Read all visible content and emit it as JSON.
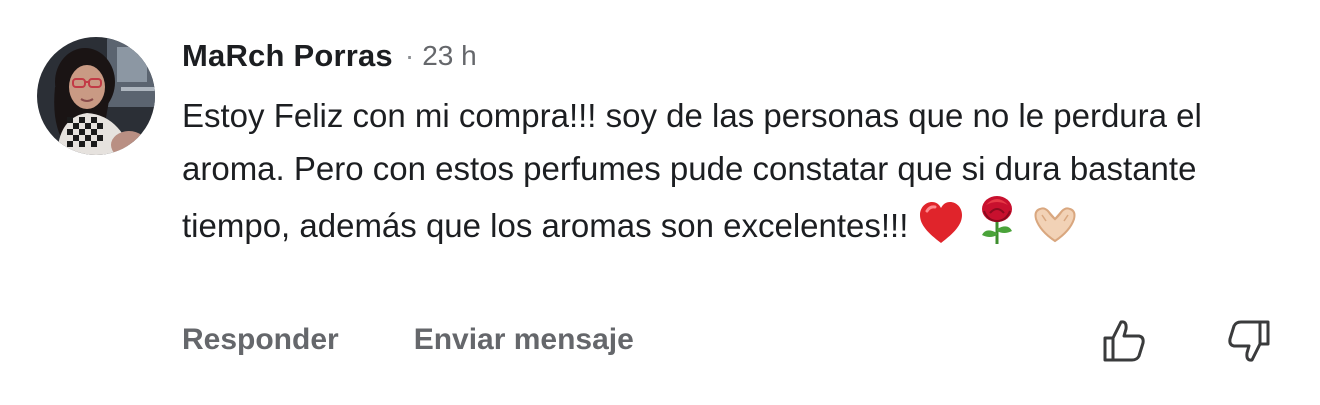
{
  "comment": {
    "author": "MaRch Porras",
    "separator": "·",
    "time": "23 h",
    "text": "Estoy Feliz con mi compra!!! soy de las personas que no le perdura el aroma. Pero con estos perfumes pude constatar que si dura bastante tiempo, además que los aromas son excelentes!!!",
    "emojis": [
      "heart-emoji",
      "rose-emoji",
      "heart-hands-emoji"
    ]
  },
  "actions": {
    "reply_label": "Responder",
    "send_message_label": "Enviar mensaje"
  },
  "icons": {
    "like": "thumbs-up-icon",
    "dislike": "thumbs-down-icon"
  },
  "colors": {
    "text_primary": "#1c1e21",
    "text_secondary": "#65676b",
    "heart": "#e0242b",
    "rose": "#c8102e"
  }
}
